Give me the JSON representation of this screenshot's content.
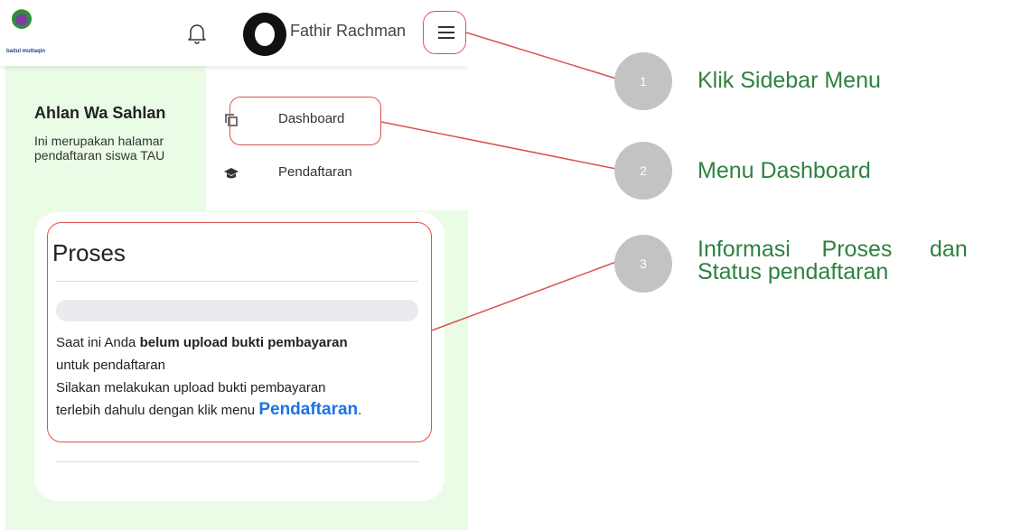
{
  "header": {
    "logo_text": "baitul muttaqin",
    "user_name": "Fathir Rachman",
    "icons": [
      "bell-icon",
      "avatar",
      "hamburger-icon"
    ]
  },
  "welcome": {
    "title": "Ahlan Wa Sahlan",
    "line1": "Ini merupakan halamar",
    "line2": "pendaftaran siswa TAU"
  },
  "menu": {
    "items": [
      {
        "label": "Dashboard",
        "icon": "copy-icon"
      },
      {
        "label": "Pendaftaran",
        "icon": "graduation-cap-icon"
      }
    ]
  },
  "proses": {
    "title": "Proses",
    "progress_percent": 0,
    "line1_prefix": "Saat ini Anda ",
    "line1_bold": "belum upload bukti pembayaran",
    "line2": "untuk pendaftaran",
    "line3": "Silakan melakukan upload bukti pembayaran",
    "line4_prefix": "terlebih dahulu dengan klik menu ",
    "line4_link": "Pendaftaran",
    "line4_suffix": "."
  },
  "annotations": [
    {
      "number": "1",
      "text": "Klik Sidebar Menu"
    },
    {
      "number": "2",
      "text": "Menu Dashboard"
    },
    {
      "number": "3",
      "text_line1": "Informasi     Proses      dan",
      "text_line2": "Status pendaftaran"
    }
  ],
  "colors": {
    "highlight": "#d9534f",
    "annotation_text": "#2e8240",
    "badge": "#c3c3c3",
    "link": "#1a73e8",
    "content_bg": "#eafce6"
  }
}
